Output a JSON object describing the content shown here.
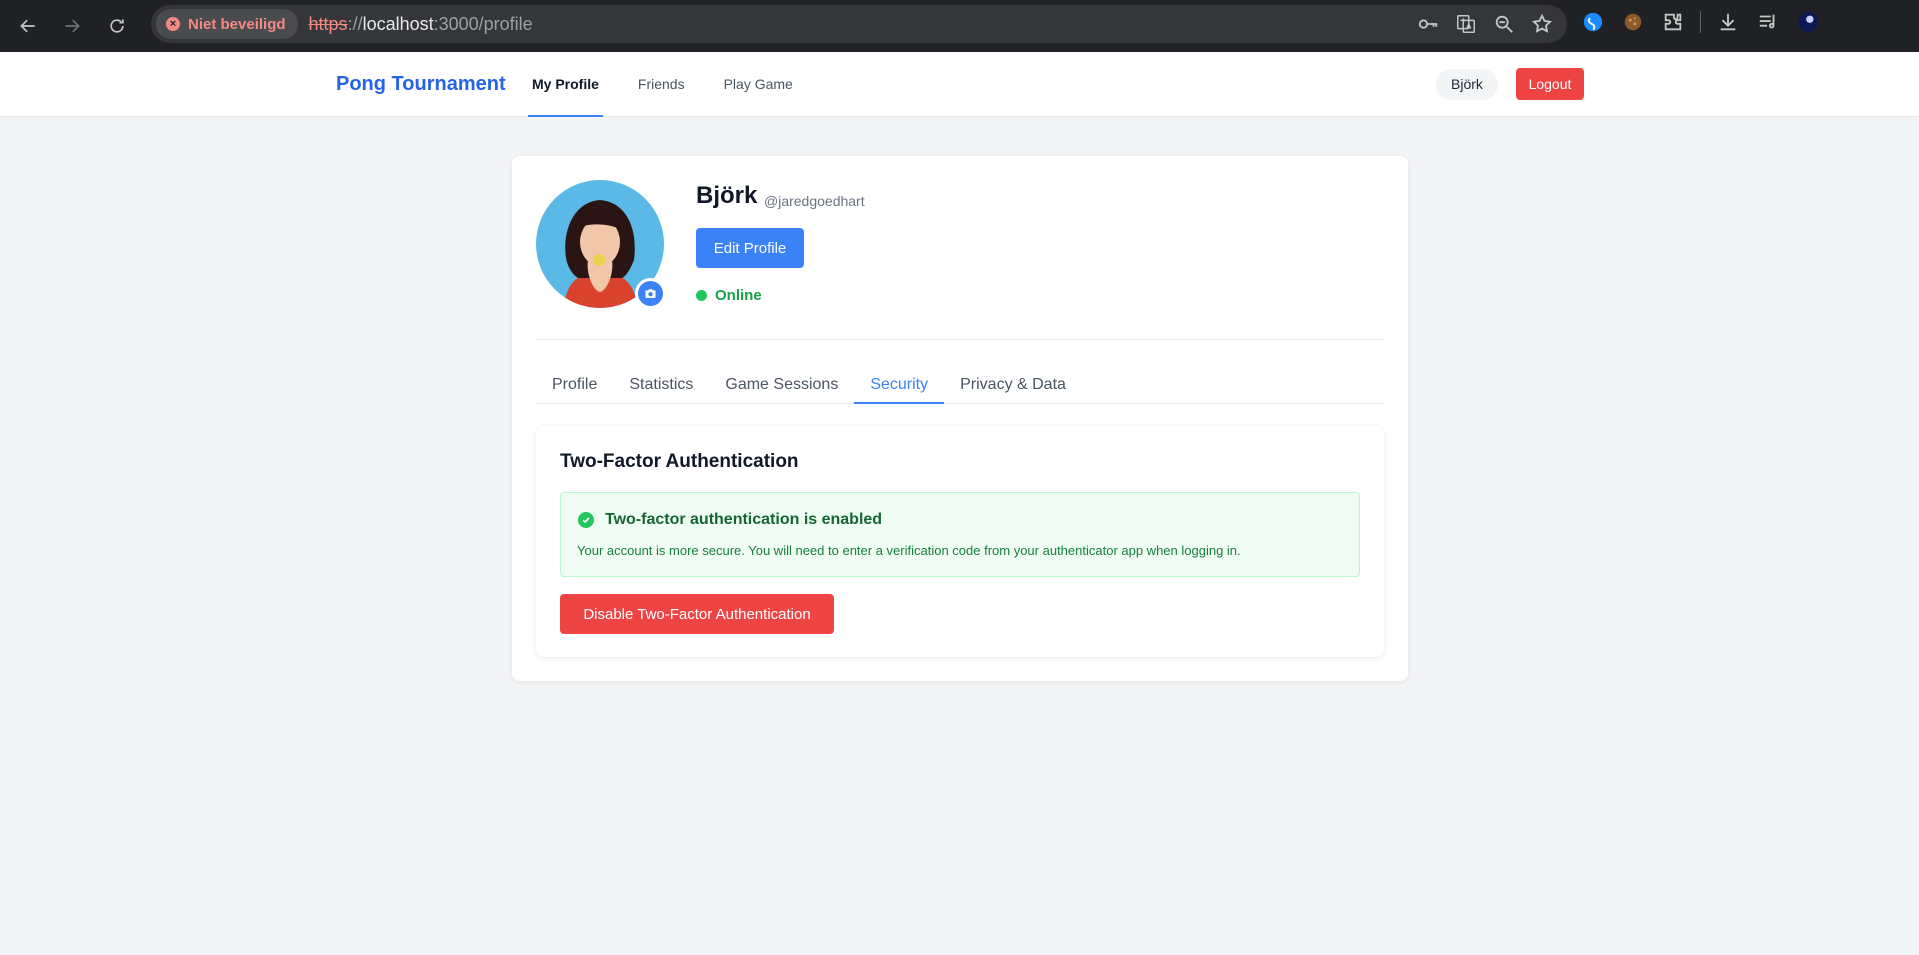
{
  "browser": {
    "security_chip": "Niet beveiligd",
    "url_scheme": "https",
    "url_sep": "://",
    "url_host": "localhost",
    "url_path": ":3000/profile"
  },
  "header": {
    "brand": "Pong Tournament",
    "nav": [
      "My Profile",
      "Friends",
      "Play Game"
    ],
    "active_nav": "My Profile",
    "user": "Björk",
    "logout": "Logout"
  },
  "profile": {
    "display_name": "Björk",
    "username": "@jaredgoedhart",
    "edit_button": "Edit Profile",
    "status": "Online",
    "status_color": "#22c55e"
  },
  "tabs": [
    "Profile",
    "Statistics",
    "Game Sessions",
    "Security",
    "Privacy & Data"
  ],
  "active_tab": "Security",
  "security": {
    "title": "Two-Factor Authentication",
    "alert_title": "Two-factor authentication is enabled",
    "alert_desc": "Your account is more secure. You will need to enter a verification code from your authenticator app when logging in.",
    "disable_button": "Disable Two-Factor Authentication"
  },
  "colors": {
    "accent": "#3b82f6",
    "brand": "#2563eb",
    "danger": "#ef4444",
    "success": "#22c55e"
  }
}
